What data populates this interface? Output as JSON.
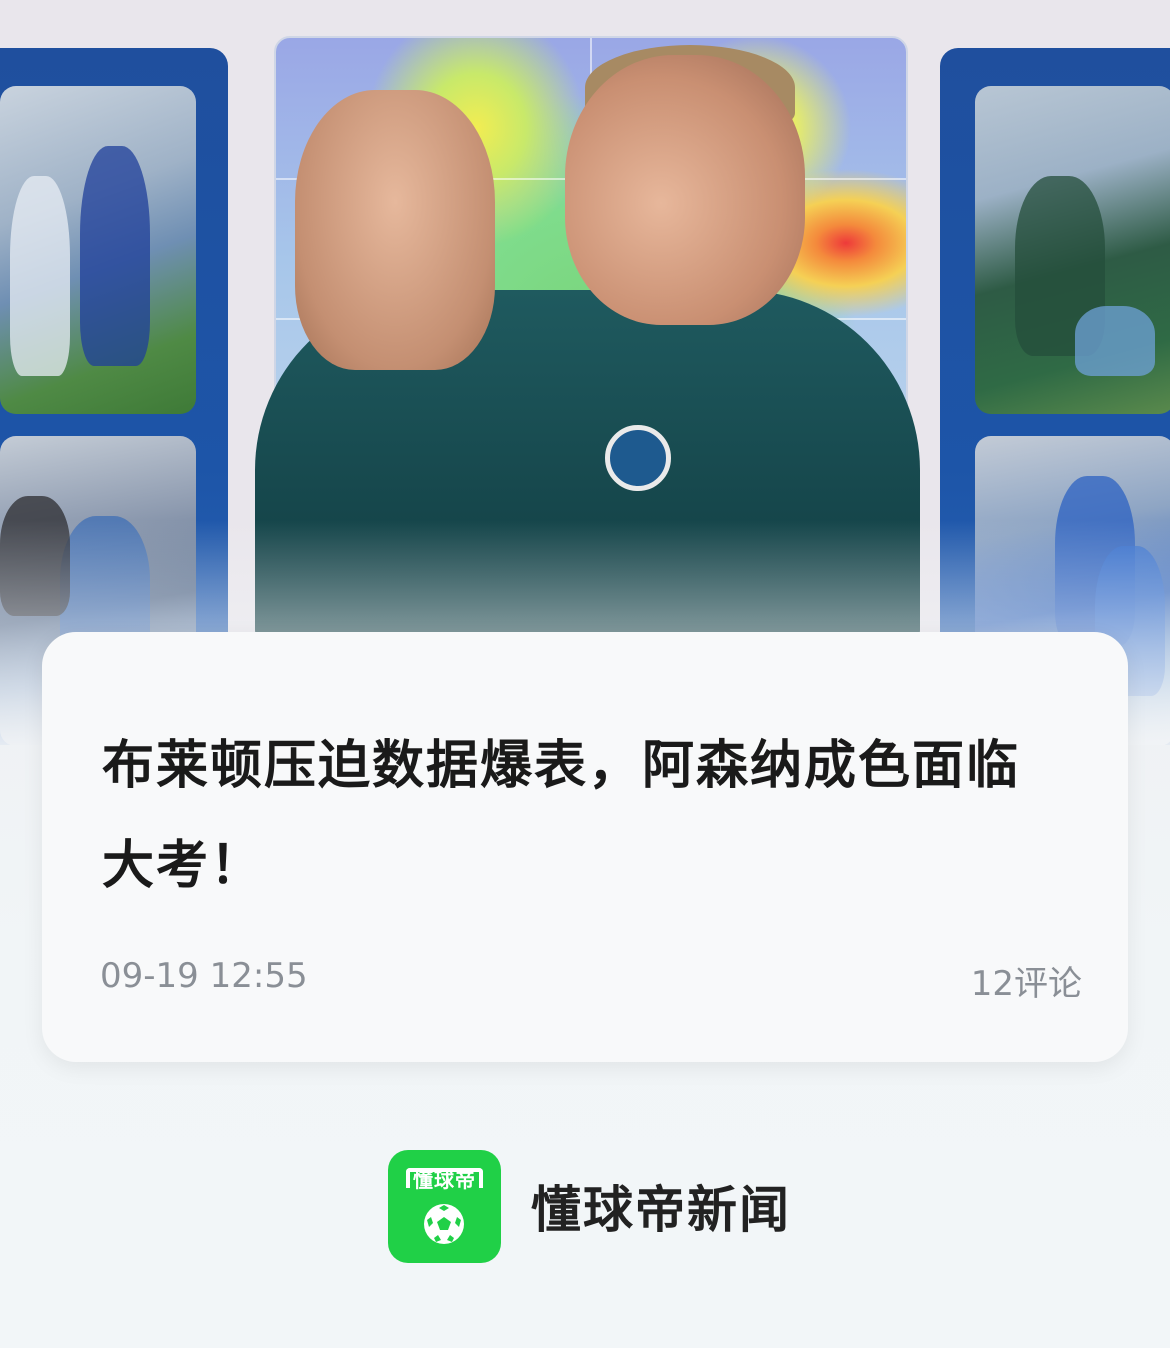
{
  "article": {
    "title": "布莱顿压迫数据爆表，阿森纳成色面临大考！",
    "date": "09-19 12:55",
    "comments": "12评论"
  },
  "brand": {
    "logo_text": "懂球帝",
    "name": "懂球帝新闻",
    "accent": "#20d047"
  },
  "hero": {
    "icons": [
      "player-photo",
      "heatmap",
      "action-photo"
    ]
  }
}
